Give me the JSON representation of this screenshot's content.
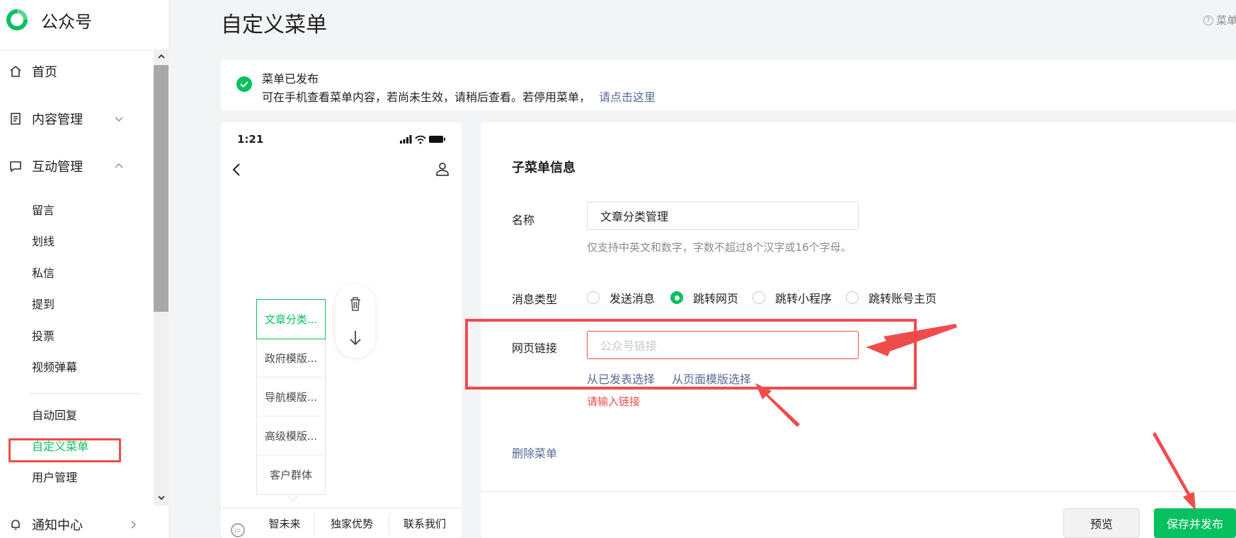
{
  "app": {
    "name": "公众号"
  },
  "sidebar": {
    "home": "首页",
    "content": "内容管理",
    "interaction": "互动管理",
    "sub_items": [
      "留言",
      "划线",
      "私信",
      "提到",
      "投票",
      "视频弹幕"
    ],
    "sub_items2": [
      "自动回复",
      "自定义菜单",
      "用户管理"
    ],
    "notify": "通知中心"
  },
  "header": {
    "title": "自定义菜单",
    "help": "菜单"
  },
  "notice": {
    "title": "菜单已发布",
    "desc": "可在手机查看菜单内容，若尚未生效，请稍后查看。若停用菜单，",
    "link": "请点击这里"
  },
  "phone": {
    "time": "1:21",
    "submenu": [
      "文章分类...",
      "政府模版...",
      "导航模版...",
      "高级模版...",
      "客户群体"
    ],
    "bottom_menu": [
      "智未来",
      "独家优势",
      "联系我们"
    ]
  },
  "form": {
    "title": "子菜单信息",
    "name_label": "名称",
    "name_value": "文章分类管理",
    "name_hint": "仅支持中英文和数字，字数不超过8个汉字或16个字母。",
    "type_label": "消息类型",
    "types": [
      "发送消息",
      "跳转网页",
      "跳转小程序",
      "跳转账号主页"
    ],
    "selected_type": "跳转网页",
    "url_label": "网页链接",
    "url_placeholder": "公众号链接",
    "link_published": "从已发表选择",
    "link_template": "从页面模版选择",
    "url_error": "请输入链接",
    "delete": "删除菜单",
    "preview": "预览",
    "publish": "保存并发布"
  },
  "colors": {
    "brand_green": "#07c160",
    "link_blue": "#576b95",
    "annotation_red": "#f04b4b"
  }
}
